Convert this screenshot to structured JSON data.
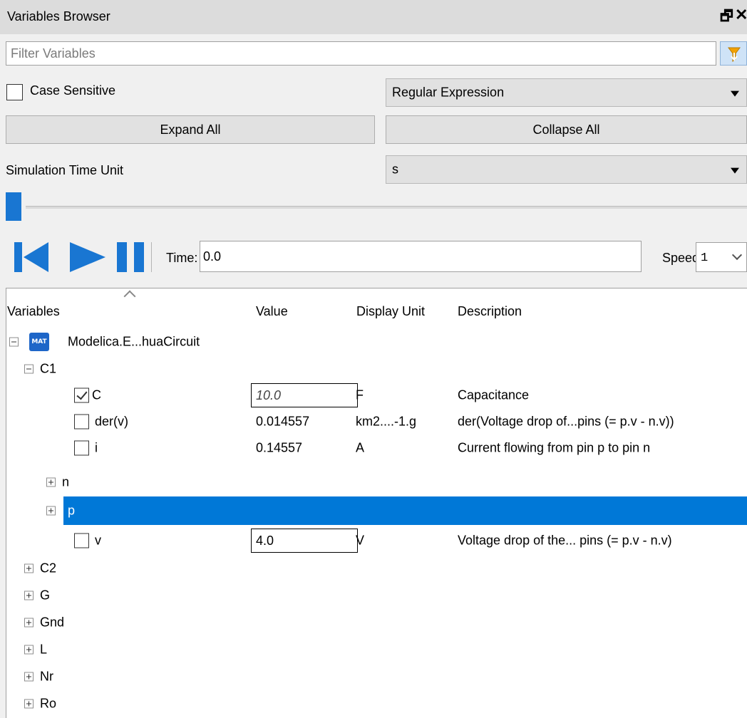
{
  "panel": {
    "title": "Variables Browser"
  },
  "filter": {
    "placeholder": "Filter Variables",
    "case_sensitive_label": "Case Sensitive",
    "case_sensitive_checked": false,
    "match_mode": "Regular Expression",
    "expand_all_label": "Expand All",
    "collapse_all_label": "Collapse All"
  },
  "time_unit": {
    "label": "Simulation Time Unit",
    "value": "s"
  },
  "playback": {
    "time_label": "Time:",
    "time_value": "0.0",
    "speed_label": "Speed:",
    "speed_value": "1",
    "slider_position": 0
  },
  "tree": {
    "columns": {
      "variables": "Variables",
      "value": "Value",
      "unit": "Display Unit",
      "description": "Description"
    },
    "root": {
      "icon": "MAT",
      "label": "Modelica.E...huaCircuit"
    },
    "c1": {
      "label": "C1"
    },
    "c1_c": {
      "name": "C",
      "value": "10.0",
      "unit": "F",
      "description": "Capacitance",
      "checked": true
    },
    "c1_derv": {
      "name": "der(v)",
      "value": "0.014557",
      "unit": "km2....-1.g",
      "description": "der(Voltage drop of...pins (= p.v - n.v))"
    },
    "c1_i": {
      "name": "i",
      "value": "0.14557",
      "unit": "A",
      "description": "Current flowing from pin p to pin n"
    },
    "c1_n": {
      "label": "n"
    },
    "c1_p": {
      "label": "p"
    },
    "c1_v": {
      "name": "v",
      "value": "4.0",
      "unit": "V",
      "description": "Voltage drop of the... pins (= p.v - n.v)"
    },
    "collapsed": [
      {
        "label": "C2"
      },
      {
        "label": "G"
      },
      {
        "label": "Gnd"
      },
      {
        "label": "L"
      },
      {
        "label": "Nr"
      },
      {
        "label": "Ro"
      }
    ]
  },
  "colors": {
    "selection": "#0078d7",
    "accent_blue": "#1976d2",
    "mat_icon": "#1e66c8"
  }
}
